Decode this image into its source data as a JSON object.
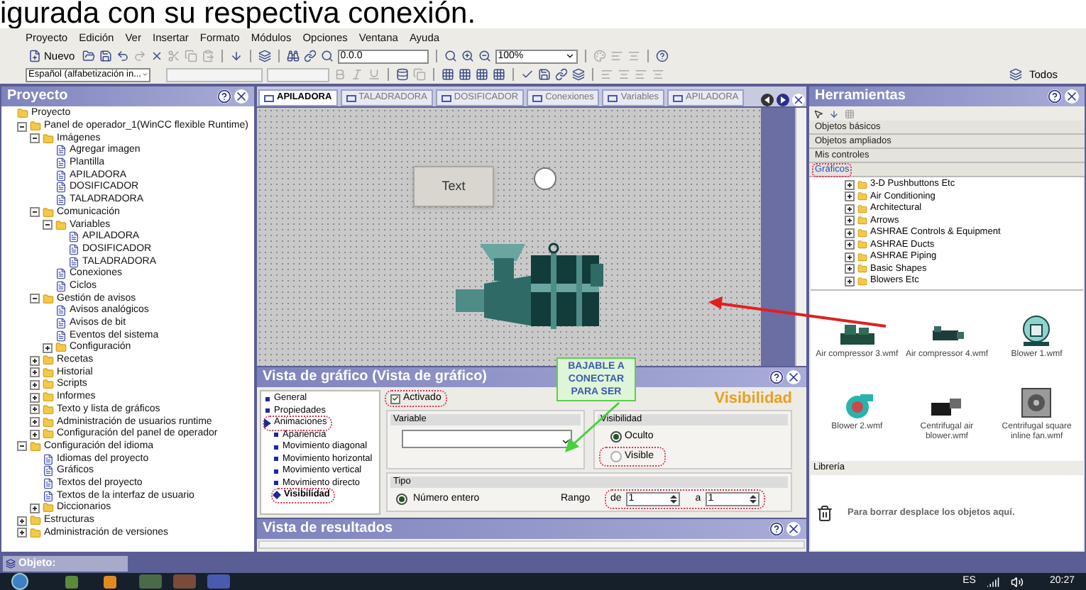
{
  "caption": "igurada con su respectiva conexión.",
  "menu": [
    "Proyecto",
    "Edición",
    "Ver",
    "Insertar",
    "Formato",
    "Módulos",
    "Opciones",
    "Ventana",
    "Ayuda"
  ],
  "toolbar": {
    "new_button": "Nuevo",
    "position_field": "0.0.0",
    "zoom_field": "100%",
    "language_field": "Español (alfabetización in...",
    "all_button": "Todos"
  },
  "project_panel": {
    "title": "Proyecto",
    "tree": [
      {
        "label": "Proyecto",
        "children": [
          {
            "label": "Panel de operador_1(WinCC flexible Runtime)",
            "expanded": true,
            "children": [
              {
                "label": "Imágenes",
                "expanded": true,
                "children": [
                  {
                    "label": "Agregar imagen"
                  },
                  {
                    "label": "Plantilla"
                  },
                  {
                    "label": "APILADORA"
                  },
                  {
                    "label": "DOSIFICADOR"
                  },
                  {
                    "label": "TALADRADORA"
                  }
                ]
              },
              {
                "label": "Comunicación",
                "expanded": true,
                "children": [
                  {
                    "label": "Variables",
                    "expanded": true,
                    "children": [
                      {
                        "label": "APILADORA"
                      },
                      {
                        "label": "DOSIFICADOR"
                      },
                      {
                        "label": "TALADRADORA"
                      }
                    ]
                  },
                  {
                    "label": "Conexiones"
                  },
                  {
                    "label": "Ciclos"
                  }
                ]
              },
              {
                "label": "Gestión de avisos",
                "expanded": true,
                "children": [
                  {
                    "label": "Avisos analógicos"
                  },
                  {
                    "label": "Avisos de bit"
                  },
                  {
                    "label": "Eventos del sistema"
                  },
                  {
                    "label": "Configuración",
                    "expanded": false
                  }
                ]
              },
              {
                "label": "Recetas",
                "expanded": false
              },
              {
                "label": "Historial",
                "expanded": false
              },
              {
                "label": "Scripts",
                "expanded": false
              },
              {
                "label": "Informes",
                "expanded": false
              },
              {
                "label": "Texto y lista de gráficos",
                "expanded": false
              },
              {
                "label": "Administración de usuarios runtime",
                "expanded": false
              },
              {
                "label": "Configuración del panel de operador",
                "expanded": false
              }
            ]
          },
          {
            "label": "Configuración del idioma",
            "expanded": true,
            "children": [
              {
                "label": "Idiomas del proyecto"
              },
              {
                "label": "Gráficos"
              },
              {
                "label": "Textos del proyecto"
              },
              {
                "label": "Textos de la interfaz de usuario"
              },
              {
                "label": "Diccionarios",
                "expanded": false
              }
            ]
          },
          {
            "label": "Estructuras",
            "expanded": false
          },
          {
            "label": "Administración de versiones",
            "expanded": false
          }
        ]
      }
    ]
  },
  "editor_tabs": [
    {
      "label": "APILADORA",
      "selected": true
    },
    {
      "label": "TALADRADORA",
      "selected": false
    },
    {
      "label": "DOSIFICADOR",
      "selected": false
    },
    {
      "label": "Conexiones",
      "selected": false
    },
    {
      "label": "Variables",
      "selected": false
    },
    {
      "label": "APILADORA",
      "selected": false
    }
  ],
  "canvas": {
    "text_button": "Text"
  },
  "properties": {
    "title": "Vista de gráfico (Vista de gráfico)",
    "section_heading": "Visibilidad",
    "nav": [
      {
        "label": "General",
        "selected": false,
        "circled": false
      },
      {
        "label": "Propiedades",
        "selected": false,
        "circled": false
      },
      {
        "label": "Animaciones",
        "selected": false,
        "circled": true,
        "children": [
          {
            "label": "Apariencia",
            "selected": false,
            "circled": false
          },
          {
            "label": "Movimiento diagonal",
            "selected": false,
            "circled": false
          },
          {
            "label": "Movimiento horizontal",
            "selected": false,
            "circled": false
          },
          {
            "label": "Movimiento vertical",
            "selected": false,
            "circled": false
          },
          {
            "label": "Movimiento directo",
            "selected": false,
            "circled": false
          },
          {
            "label": "Visibilidad",
            "selected": true,
            "circled": true
          }
        ]
      }
    ],
    "enabled": {
      "label": "Activado",
      "checked": true,
      "circled": true
    },
    "variable": {
      "label": "Variable"
    },
    "visibility": {
      "label": "Visibilidad",
      "options": [
        {
          "label": "Oculto",
          "selected": true,
          "circled": false
        },
        {
          "label": "Visible",
          "selected": false,
          "circled": true
        }
      ]
    },
    "type": {
      "label": "Tipo",
      "option": {
        "label": "Número entero",
        "selected": true
      },
      "range_label": "Rango",
      "from_label": "de",
      "from_value": "1",
      "to_label": "a",
      "to_value": "1",
      "circled": true
    }
  },
  "callout": [
    "BAJABLE A",
    "CONECTAR",
    "PARA SER"
  ],
  "results": {
    "title": "Vista de resultados"
  },
  "tools_panel": {
    "title": "Herramientas",
    "sections": [
      {
        "label": "Objetos básicos",
        "selected": false
      },
      {
        "label": "Objetos ampliados",
        "selected": false
      },
      {
        "label": "Mis controles",
        "selected": false
      },
      {
        "label": "Gráficos",
        "selected": true
      }
    ],
    "folders": [
      "3-D Pushbuttons Etc",
      "Air Conditioning",
      "Architectural",
      "Arrows",
      "ASHRAE Controls & Equipment",
      "ASHRAE Ducts",
      "ASHRAE Piping",
      "Basic Shapes",
      "Blowers Etc"
    ],
    "gallery": [
      {
        "name": "Air compressor 3.wmf",
        "kind": "compressor"
      },
      {
        "name": "Air compressor 4.wmf",
        "kind": "pump"
      },
      {
        "name": "Blower 1.wmf",
        "kind": "blower"
      },
      {
        "name": "Blower 2.wmf",
        "kind": "fan"
      },
      {
        "name": "Centrifugal air blower.wmf",
        "kind": "motor"
      },
      {
        "name": "Centrifugal square inline fan.wmf",
        "kind": "box"
      }
    ],
    "library_label": "Librería",
    "trash_hint": "Para borrar desplace los objetos aquí."
  },
  "status": {
    "object_label": "Objeto:"
  },
  "taskbar": {
    "language": "ES",
    "clock": "20:27"
  }
}
